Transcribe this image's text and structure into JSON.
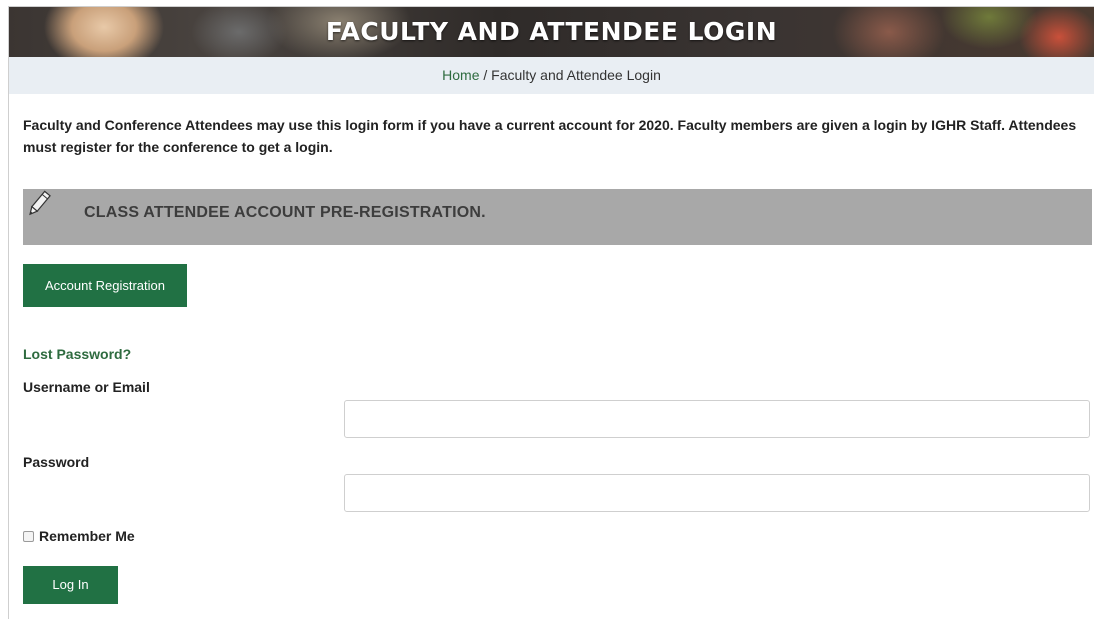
{
  "banner": {
    "title": "FACULTY AND ATTENDEE LOGIN"
  },
  "breadcrumb": {
    "home": "Home",
    "separator": " / ",
    "current": "Faculty and Attendee Login"
  },
  "intro": {
    "text": "Faculty and Conference Attendees may use this login form if you have a current account for 2020.  Faculty members are given a login by IGHR Staff.  Attendees must register for the conference to get a login."
  },
  "section": {
    "icon": "pencil-icon",
    "title": "CLASS ATTENDEE ACCOUNT PRE-REGISTRATION."
  },
  "registration_button": {
    "label": "Account Registration"
  },
  "form": {
    "lost_password": "Lost Password?",
    "username_label": "Username or Email",
    "username_value": "",
    "password_label": "Password",
    "password_value": "",
    "remember_label": "Remember Me",
    "remember_checked": false,
    "login_label": "Log In"
  },
  "colors": {
    "accent_green": "#217144",
    "link_green": "#2e6b3f",
    "breadcrumb_bg": "#e9eef3",
    "section_bar_bg": "#a8a8a8"
  }
}
